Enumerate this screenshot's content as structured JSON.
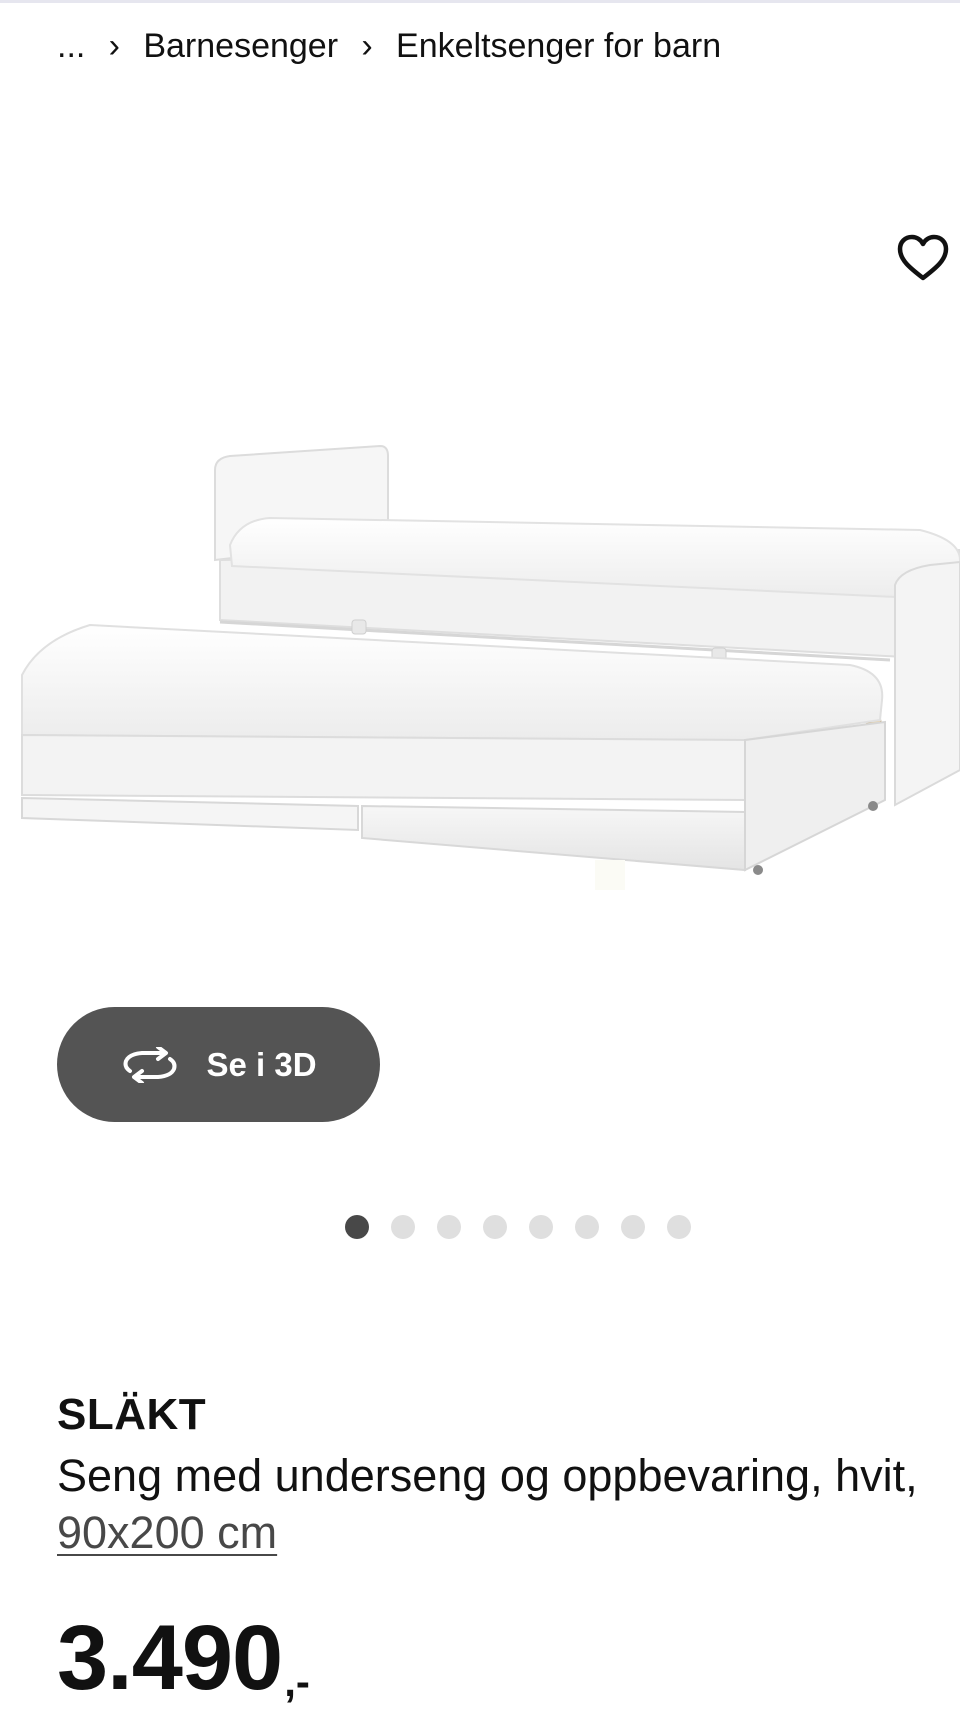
{
  "breadcrumb": {
    "ellipsis": "...",
    "items": [
      "Barnesenger",
      "Enkeltsenger for barn"
    ]
  },
  "icons": {
    "favorite": "heart-outline-icon",
    "rotate_3d": "rotate-arrows-icon",
    "separator": "chevron-right-icon"
  },
  "view3d": {
    "label": "Se i 3D"
  },
  "carousel": {
    "total": 8,
    "active_index": 0
  },
  "product": {
    "name": "SLÄKT",
    "description_prefix": "Seng med underseng og oppbevaring, hvit, ",
    "size_link": "90x200 cm",
    "price_amount": "3.490",
    "price_suffix": ",-"
  },
  "colors": {
    "button_bg": "#545454",
    "dot_active": "#484848",
    "dot_inactive": "#dfdfdf",
    "text": "#111111"
  }
}
